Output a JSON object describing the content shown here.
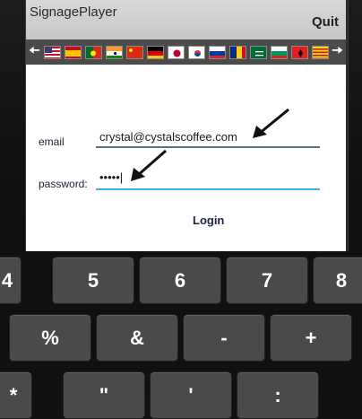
{
  "app": {
    "title": "SignagePlayer",
    "quit_label": "Quit"
  },
  "languages": {
    "prev_icon": "arrow-left-icon",
    "next_icon": "arrow-right-icon",
    "flags": [
      "us",
      "es",
      "pt",
      "in",
      "cn",
      "de",
      "jp",
      "kr",
      "ru",
      "ro",
      "sa",
      "bg",
      "al",
      "ca"
    ]
  },
  "form": {
    "email_label": "email",
    "email_value": "crystal@cystalscoffee.com",
    "password_label": "password:",
    "password_value": "•••••|",
    "login_label": "Login"
  },
  "keyboard": {
    "row1": [
      "4",
      "5",
      "6",
      "7",
      "8"
    ],
    "row2": [
      "%",
      "&",
      "-",
      "+"
    ],
    "row3": [
      "*",
      "\"",
      "'",
      ":"
    ]
  }
}
